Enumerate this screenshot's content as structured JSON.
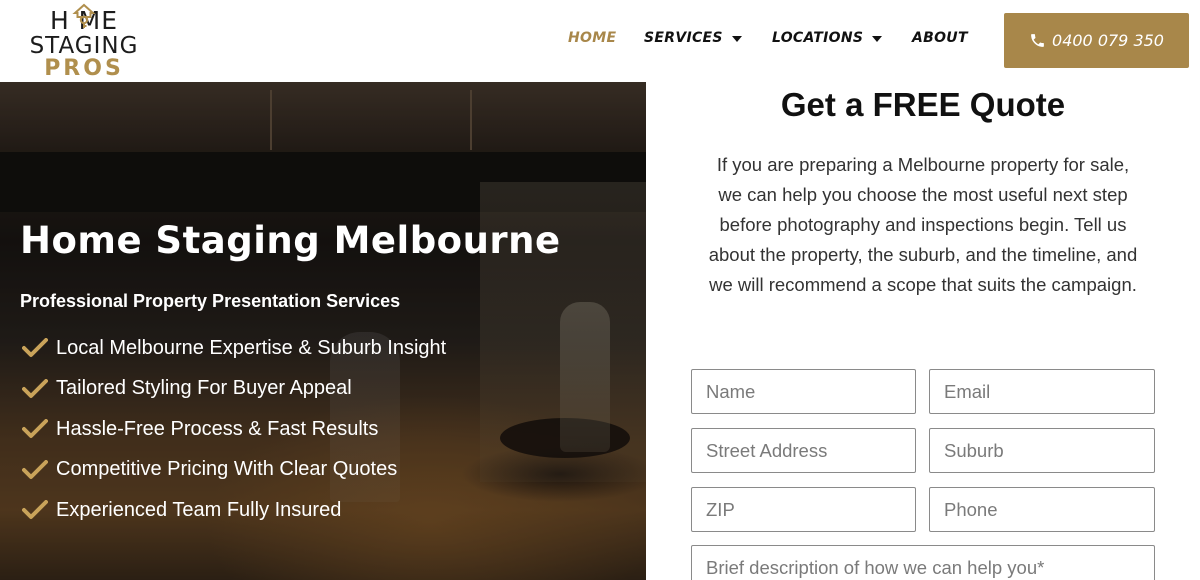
{
  "logo": {
    "line1": "H  ME",
    "line2": "STAGING",
    "line3": "PROS",
    "key_icon": "house-key-icon",
    "brand_gold": "#b08f4d"
  },
  "nav": {
    "items": [
      {
        "label": "HOME",
        "active": true,
        "dropdown": false
      },
      {
        "label": "SERVICES",
        "active": false,
        "dropdown": true
      },
      {
        "label": "LOCATIONS",
        "active": false,
        "dropdown": true
      },
      {
        "label": "ABOUT",
        "active": false,
        "dropdown": false
      }
    ],
    "active_color": "#a8874a"
  },
  "phone_button": {
    "label": "0400 079 350",
    "icon": "phone-icon",
    "color": "#a8874a"
  },
  "hero": {
    "title": "Home Staging Melbourne",
    "subtitle": "Professional Property Presentation Services",
    "check_icon": "check-icon",
    "check_color": "#c9a35a",
    "features": [
      "Local Melbourne Expertise & Suburb Insight",
      "Tailored Styling For Buyer Appeal",
      "Hassle-Free Process & Fast Results",
      "Competitive Pricing With Clear Quotes",
      "Experienced Team Fully Insured"
    ]
  },
  "quote": {
    "title": "Get a FREE Quote",
    "description": "If you are preparing a Melbourne property for sale, we can help you choose the most useful next step before photography and inspections begin. Tell us about the property, the suburb, and the timeline, and we will recommend a scope that suits the campaign.",
    "fields": {
      "name": {
        "placeholder": "Name",
        "value": ""
      },
      "email": {
        "placeholder": "Email",
        "value": ""
      },
      "street": {
        "placeholder": "Street Address",
        "value": ""
      },
      "suburb": {
        "placeholder": "Suburb",
        "value": ""
      },
      "zip": {
        "placeholder": "ZIP",
        "value": ""
      },
      "phone": {
        "placeholder": "Phone",
        "value": ""
      },
      "description": {
        "placeholder": "Brief description of how we can help you*",
        "value": ""
      }
    }
  }
}
